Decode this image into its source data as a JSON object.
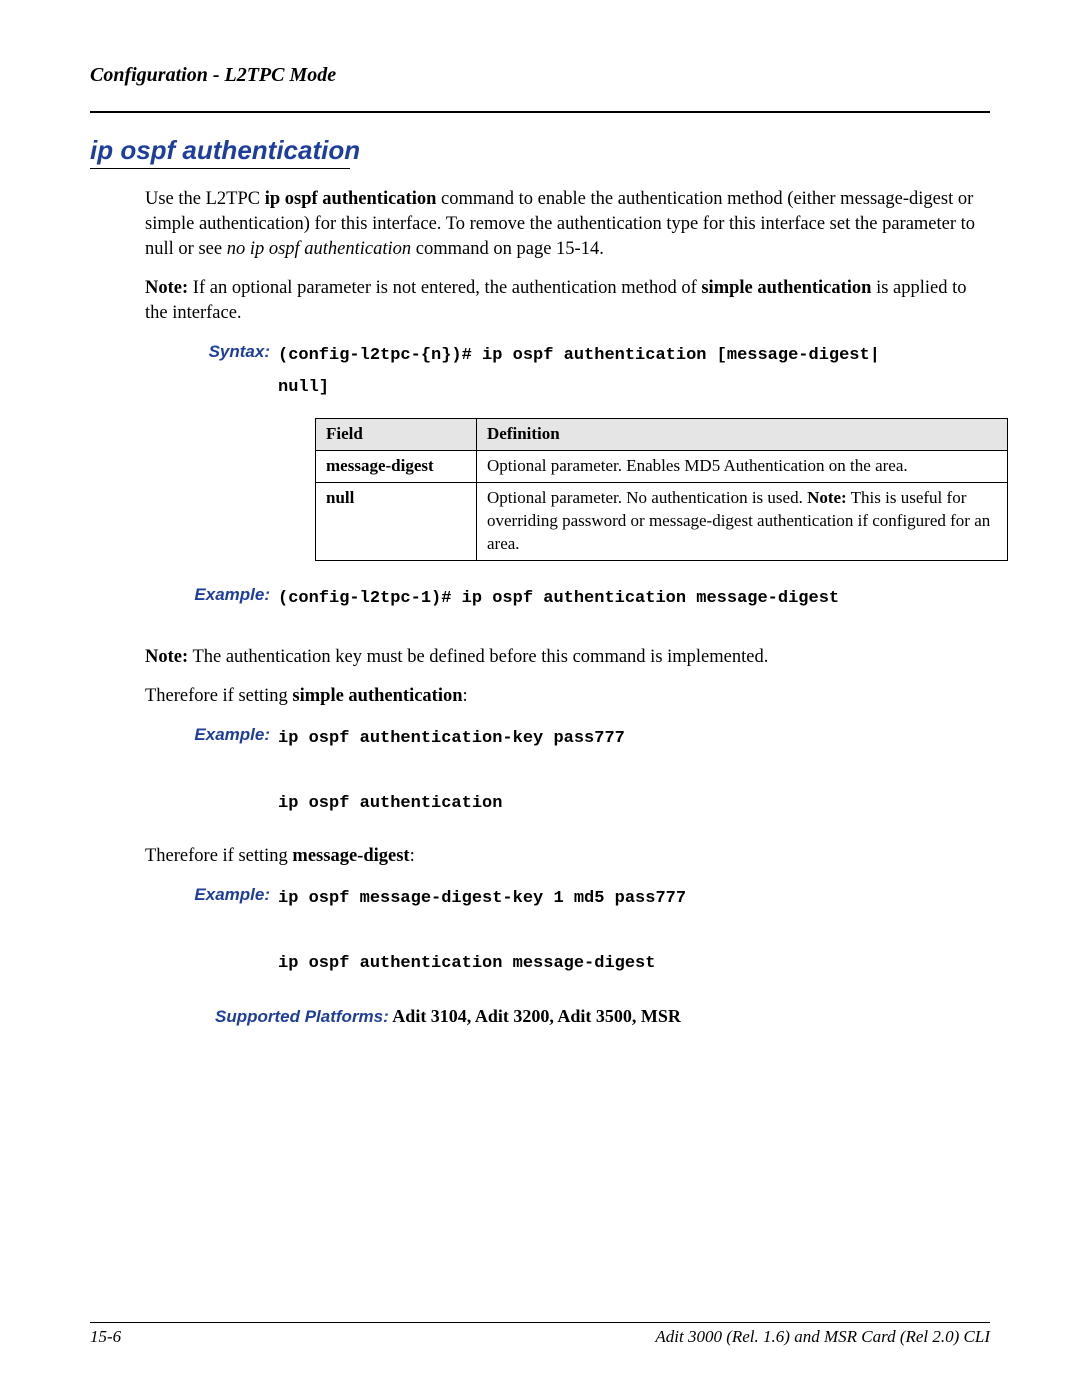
{
  "header": {
    "running_head": "Configuration - L2TPC Mode"
  },
  "section": {
    "title": "ip ospf authentication"
  },
  "paragraphs": {
    "intro_pre": "Use the L2TPC ",
    "intro_cmd": "ip ospf authentication",
    "intro_mid": " command to enable the authentication method  (either message-digest or simple authentication) for this interface. To remove the authentication type for this interface set the parameter to null or see ",
    "intro_ref": "no ip ospf authentication",
    "intro_post": " command on page 15-14.",
    "note1_label": "Note:",
    "note1_text": " If an optional parameter is not entered, the authentication method of ",
    "note1_bold": "simple authentication",
    "note1_tail": " is applied to the interface.",
    "note2_label": "Note:",
    "note2_text": " The authentication key must be defined before this command is implemented.",
    "therefore_simple_pre": "Therefore if setting ",
    "therefore_simple_bold": "simple authentication",
    "therefore_simple_post": ":",
    "therefore_md_pre": "Therefore if setting ",
    "therefore_md_bold": "message-digest",
    "therefore_md_post": ":"
  },
  "labels": {
    "syntax": "Syntax:",
    "example": "Example:",
    "platforms": "Supported Platforms:"
  },
  "code": {
    "syntax": "(config-l2tpc-{n})# ip ospf authentication [message-digest|\nnull]",
    "example1": "(config-l2tpc-1)# ip ospf authentication message-digest",
    "example2": "ip ospf authentication-key pass777\n\nip ospf authentication",
    "example3": "ip ospf message-digest-key 1 md5 pass777\n\nip ospf authentication message-digest"
  },
  "table": {
    "headers": {
      "field": "Field",
      "definition": "Definition"
    },
    "rows": [
      {
        "field": "message-digest",
        "def_pre": "Optional parameter. Enables MD5 Authentication on the area.",
        "def_note_label": "",
        "def_note_text": ""
      },
      {
        "field": "null",
        "def_pre": "Optional parameter. No authentication is used. ",
        "def_note_label": "Note:",
        "def_note_text": " This is useful for overriding password or message-digest authentication  if configured for an area."
      }
    ]
  },
  "platforms": {
    "value": " Adit 3104, Adit 3200, Adit 3500, MSR"
  },
  "footer": {
    "left": "15-6",
    "right": "Adit 3000 (Rel. 1.6) and MSR Card (Rel 2.0) CLI"
  }
}
